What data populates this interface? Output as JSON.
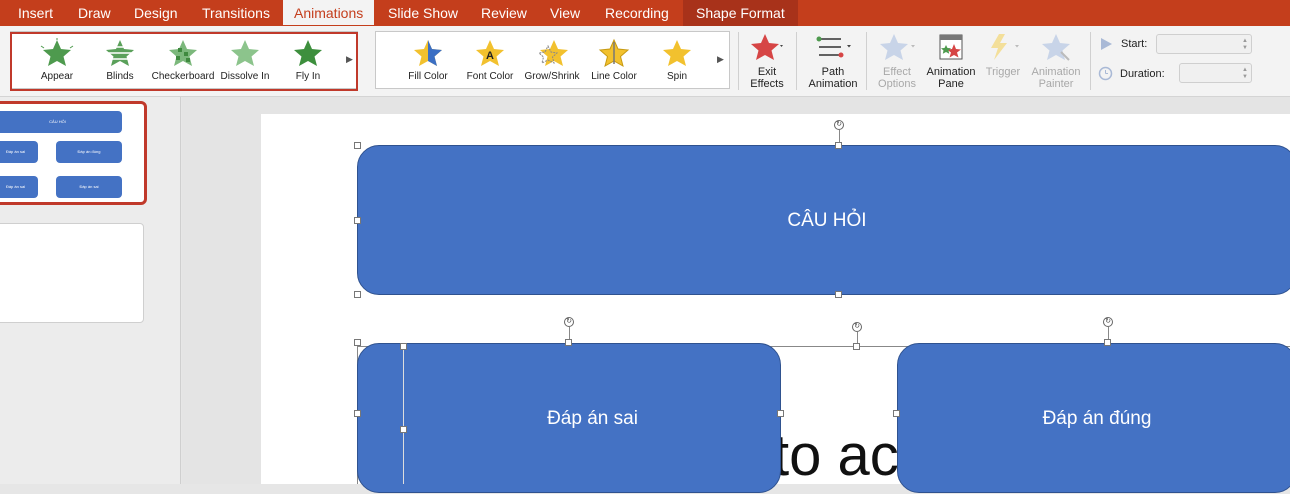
{
  "tabs": [
    {
      "label": "Insert",
      "active": false
    },
    {
      "label": "Draw",
      "active": false
    },
    {
      "label": "Design",
      "active": false
    },
    {
      "label": "Transitions",
      "active": false
    },
    {
      "label": "Animations",
      "active": true
    },
    {
      "label": "Slide Show",
      "active": false
    },
    {
      "label": "Review",
      "active": false
    },
    {
      "label": "View",
      "active": false
    },
    {
      "label": "Recording",
      "active": false
    },
    {
      "label": "Shape Format",
      "active": false,
      "contextual": true
    }
  ],
  "entrance_effects": [
    {
      "label": "Appear",
      "icon": "star-appear-icon"
    },
    {
      "label": "Blinds",
      "icon": "star-blinds-icon"
    },
    {
      "label": "Checkerboard",
      "icon": "star-checkerboard-icon"
    },
    {
      "label": "Dissolve In",
      "icon": "star-dissolve-icon"
    },
    {
      "label": "Fly In",
      "icon": "star-flyin-icon"
    }
  ],
  "emphasis_effects": [
    {
      "label": "Fill Color",
      "icon": "star-fill-color-icon"
    },
    {
      "label": "Font Color",
      "icon": "star-font-color-icon"
    },
    {
      "label": "Grow/Shrink",
      "icon": "star-grow-shrink-icon"
    },
    {
      "label": "Line Color",
      "icon": "star-line-color-icon"
    },
    {
      "label": "Spin",
      "icon": "star-spin-icon"
    }
  ],
  "buttons": {
    "exit_effects": [
      "Exit",
      "Effects"
    ],
    "path_animation": [
      "Path",
      "Animation"
    ],
    "effect_options": [
      "Effect",
      "Options"
    ],
    "animation_pane": [
      "Animation",
      "Pane"
    ],
    "trigger": "Trigger",
    "animation_painter": [
      "Animation",
      "Painter"
    ]
  },
  "timing": {
    "start_label": "Start:",
    "start_value": "",
    "duration_label": "Duration:",
    "duration_value": ""
  },
  "colors": {
    "accent": "#c43e1c",
    "shape_fill": "#4472c4",
    "highlight_box": "#c0392b",
    "effect_green": "#5aa05a",
    "effect_gold": "#f2c12e"
  },
  "slide": {
    "question": "CÂU HỎI",
    "answer_wrong": "Đáp án sai",
    "answer_right": "Đáp án đúng",
    "partial_text": "to ac"
  }
}
